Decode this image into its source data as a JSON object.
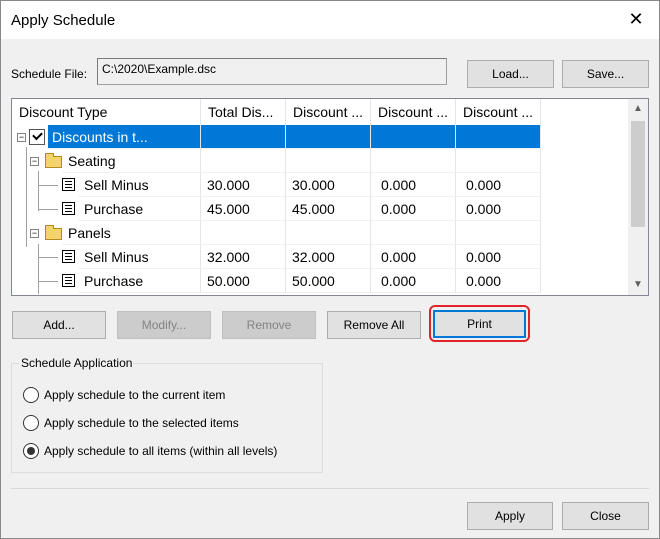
{
  "window": {
    "title": "Apply Schedule"
  },
  "schedule_file": {
    "label": "Schedule File:",
    "path": "C:\\2020\\Example.dsc",
    "load_label": "Load...",
    "save_label": "Save..."
  },
  "tree": {
    "columns": [
      "Discount Type",
      "Total Dis...",
      "Discount ...",
      "Discount ...",
      "Discount ..."
    ],
    "rows": [
      {
        "name": "Discounts in t...",
        "values": [
          "",
          "",
          "",
          ""
        ]
      },
      {
        "name": "Seating",
        "values": [
          "",
          "",
          "",
          ""
        ]
      },
      {
        "name": "Sell Minus",
        "values": [
          "30.000",
          "30.000",
          "0.000",
          "0.000"
        ]
      },
      {
        "name": "Purchase",
        "values": [
          "45.000",
          "45.000",
          "0.000",
          "0.000"
        ]
      },
      {
        "name": "Panels",
        "values": [
          "",
          "",
          "",
          ""
        ]
      },
      {
        "name": "Sell Minus",
        "values": [
          "32.000",
          "32.000",
          "0.000",
          "0.000"
        ]
      },
      {
        "name": "Purchase",
        "values": [
          "50.000",
          "50.000",
          "0.000",
          "0.000"
        ]
      }
    ]
  },
  "actions": {
    "add": "Add...",
    "modify": "Modify...",
    "remove": "Remove",
    "remove_all": "Remove All",
    "print": "Print"
  },
  "application": {
    "title": "Schedule Application",
    "options": [
      "Apply schedule to the current item",
      "Apply schedule to the selected items",
      "Apply schedule to all items (within all levels)"
    ],
    "selected_index": 2
  },
  "footer": {
    "apply": "Apply",
    "close": "Close"
  }
}
